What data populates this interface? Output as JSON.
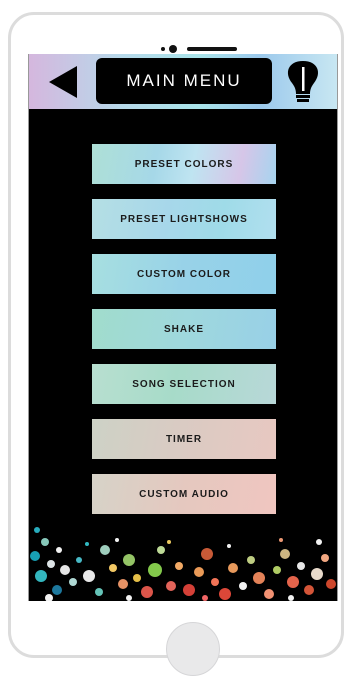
{
  "header": {
    "title": "MAIN MENU"
  },
  "menu": {
    "items": [
      {
        "label": "PRESET COLORS"
      },
      {
        "label": "PRESET LIGHTSHOWS"
      },
      {
        "label": "CUSTOM COLOR"
      },
      {
        "label": "SHAKE"
      },
      {
        "label": "SONG SELECTION"
      },
      {
        "label": "TIMER"
      },
      {
        "label": "CUSTOM AUDIO"
      }
    ]
  },
  "icons": {
    "back": "back-arrow-icon",
    "bulb": "light-bulb-icon"
  },
  "colors": {
    "screen_bg": "#000000",
    "header_gradient_start": "#d5b7de",
    "header_gradient_end": "#c8e7f2",
    "title_text": "#ffffff",
    "button_text": "#1b1b1b"
  }
}
